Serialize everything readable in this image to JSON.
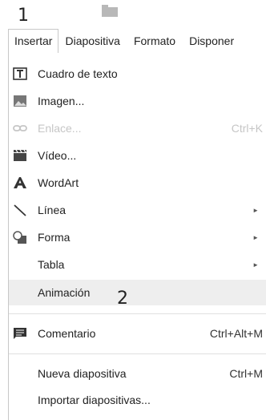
{
  "annotations": {
    "first": "1",
    "second": "2"
  },
  "menubar": {
    "items": [
      "Insertar",
      "Diapositiva",
      "Formato",
      "Disponer"
    ]
  },
  "menu": {
    "items": [
      {
        "label": "Cuadro de texto",
        "icon": "text-box-icon"
      },
      {
        "label": "Imagen...",
        "icon": "image-icon"
      },
      {
        "label": "Enlace...",
        "icon": "link-icon",
        "shortcut": "Ctrl+K",
        "disabled": true
      },
      {
        "label": "Vídeo...",
        "icon": "video-icon"
      },
      {
        "label": "WordArt",
        "icon": "wordart-icon"
      },
      {
        "label": "Línea",
        "icon": "line-icon",
        "submenu": "►"
      },
      {
        "label": "Forma",
        "icon": "shape-icon",
        "submenu": "►"
      },
      {
        "label": "Tabla",
        "submenu": "►"
      },
      {
        "label": "Animación",
        "highlighted": true
      },
      {
        "label": "Comentario",
        "icon": "comment-icon",
        "shortcut": "Ctrl+Alt+M"
      },
      {
        "label": "Nueva diapositiva",
        "shortcut": "Ctrl+M"
      },
      {
        "label": "Importar diapositivas..."
      }
    ]
  }
}
